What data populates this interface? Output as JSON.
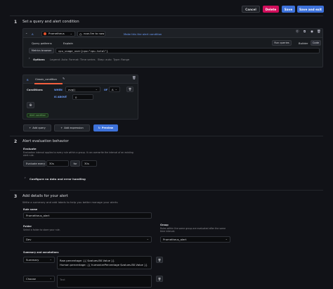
{
  "header": {
    "cancel_label": "Cancel",
    "delete_label": "Delete",
    "save_label": "Save",
    "save_exit_label": "Save and exit"
  },
  "step1": {
    "number": "1",
    "title": "Set a query and alert condition",
    "query": {
      "ref_id": "A",
      "datasource": "Prometheus",
      "time_range": "now-5m to now",
      "make_condition": "Make this the alert condition",
      "tabs": [
        "Query patterns",
        "Explain"
      ],
      "run_queries": "Run queries",
      "builder": "Builder",
      "code": "Code",
      "metrics_browser": "Metrics browser",
      "expression": "cpu_usage_user{cpu=\"cpu-total\"}",
      "options_label": "Options",
      "options_items": [
        "Legend: Auto",
        "Format: Time series",
        "Step: auto",
        "Type: Range"
      ]
    },
    "expression": {
      "ref_id": "B",
      "type": "Classic_condition",
      "conditions_label": "Conditions",
      "when": "WHEN",
      "func": "avg()",
      "of": "OF",
      "query_ref": "A",
      "is_above": "IS ABOVE",
      "threshold": "0",
      "alert_condition": "Alert condition"
    },
    "add_query": "Add query",
    "add_expression": "Add expression",
    "preview": "Preview"
  },
  "step2": {
    "number": "2",
    "title": "Alert evaluation behavior",
    "evaluate_label": "Evaluate",
    "evaluate_desc": "Evaluation interval applies to every rule within a group. It can overwrite the interval of an existing alert rule.",
    "evaluate_every": "Evaluate every",
    "every_value": "30s",
    "for_label": "for",
    "for_value": "30s",
    "configure_nodata": "Configure no data and error handling"
  },
  "step3": {
    "number": "3",
    "title": "Add details for your alert",
    "subtitle": "Write a summary and add labels to help you better manage your alerts",
    "rule_name_label": "Rule name",
    "rule_name_value": "Prometheus_alert",
    "folder_label": "Folder",
    "folder_desc": "Select a folder to store your rule.",
    "folder_value": "Dev",
    "group_label": "Group",
    "group_desc": "Rules within the same group are evaluated after the same time interval.",
    "group_value": "Prometheus_alert",
    "annotations_label": "Summary and annotations",
    "annotation1_key": "Summary",
    "annotation1_value_line1": "Raw percentage: {{ $values.B0.Value }}",
    "annotation1_value_line2": "Human percentage: {{ humanizePercentage $values.B0.Value }}",
    "annotation2_key": "Choose",
    "annotation2_placeholder": "Text"
  },
  "colors": {
    "primary": "#3d71d9",
    "destructive": "#d10e5c",
    "background": "#111217",
    "panel": "#181b1f",
    "accent_red": "#f55f3e"
  }
}
